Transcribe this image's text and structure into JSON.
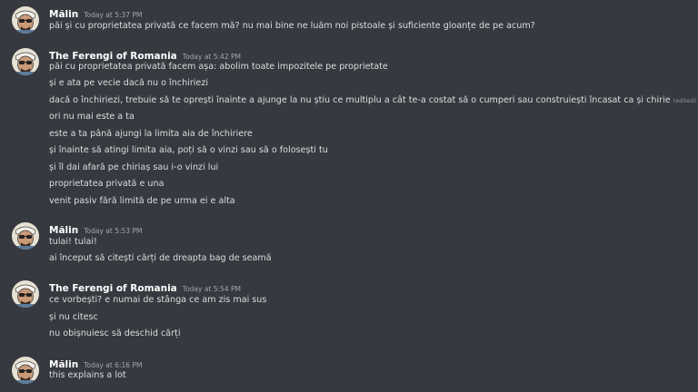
{
  "messages": [
    {
      "author": "Mălin",
      "timestamp": "Today at 5:37 PM",
      "lines": [
        {
          "text": "păi și cu proprietatea privată ce facem mă? nu mai bine ne luăm noi pistoale și suficiente gloanțe de pe acum?"
        }
      ]
    },
    {
      "author": "The Ferengi of Romania",
      "timestamp": "Today at 5:42 PM",
      "lines": [
        {
          "text": "păi cu proprietatea privată facem așa: abolim toate impozitele pe proprietate"
        },
        {
          "text": "și e ata pe vecie dacă nu o închiriezi"
        },
        {
          "text": "dacă o închiriezi, trebuie să te oprești înainte a ajunge la nu știu ce multiplu a cât te-a costat să o cumperi sau construiești încasat ca și chirie",
          "edited": "(edited)"
        },
        {
          "text": "ori nu mai este a ta"
        },
        {
          "text": "este a ta până ajungi la limita aia de închiriere"
        },
        {
          "text": "și înainte să atingi limita aia, poți să o vinzi sau să o folosești tu"
        },
        {
          "text": "și îl dai afară pe chiriaș sau i-o vinzi lui"
        },
        {
          "text": "proprietatea privată e una"
        },
        {
          "text": "venit pasiv fără limită de pe urma ei e alta"
        }
      ]
    },
    {
      "author": "Mălin",
      "timestamp": "Today at 5:53 PM",
      "lines": [
        {
          "text": "tulai! tulai!"
        },
        {
          "text": "ai început să citești cărți de dreapta bag de seamă"
        }
      ]
    },
    {
      "author": "The Ferengi of Romania",
      "timestamp": "Today at 5:54 PM",
      "lines": [
        {
          "text": "ce vorbești? e numai de stânga ce am zis mai sus"
        },
        {
          "text": "și nu citesc"
        },
        {
          "text": "nu obișnuiesc să deschid cărți"
        }
      ]
    },
    {
      "author": "Mălin",
      "timestamp": "Today at 6:16 PM",
      "lines": [
        {
          "text": "this explains a lot"
        }
      ]
    }
  ]
}
